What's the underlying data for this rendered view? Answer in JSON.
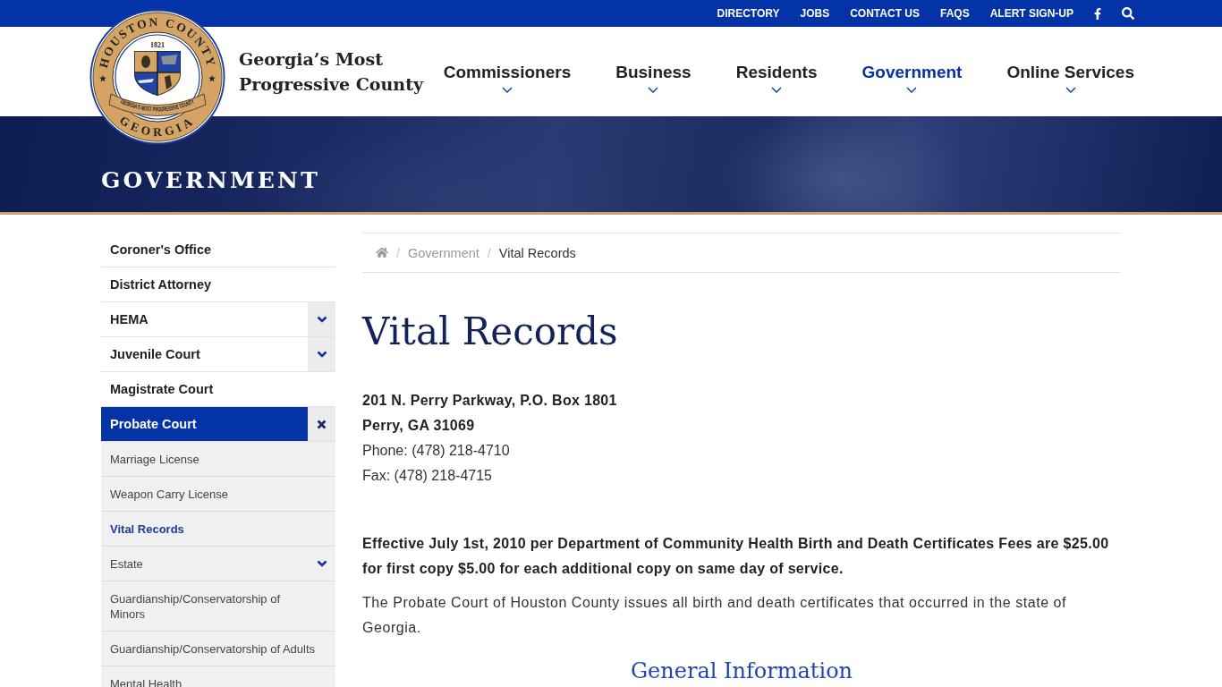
{
  "top_bar": {
    "links": [
      "DIRECTORY",
      "JOBS",
      "CONTACT US",
      "FAQS",
      "ALERT SIGN-UP"
    ]
  },
  "header": {
    "seal": {
      "top_text": "HOUSTON COUNTY",
      "year": "1821",
      "ribbon_text": "GEORGIA'S MOST PROGRESSIVE COUNTY",
      "bottom_text": "GEORGIA"
    },
    "tagline": "Georgia’s Most Progressive County"
  },
  "nav": [
    {
      "label": "Commissioners",
      "selected": false
    },
    {
      "label": "Business",
      "selected": false
    },
    {
      "label": "Residents",
      "selected": false
    },
    {
      "label": "Government",
      "selected": true
    },
    {
      "label": "Online Services",
      "selected": false
    }
  ],
  "hero": {
    "title": "GOVERNMENT"
  },
  "sidebar": {
    "items": [
      {
        "label": "Coroner's Office",
        "selected": false,
        "kind": "link"
      },
      {
        "label": "District Attorney",
        "selected": false,
        "kind": "link"
      },
      {
        "label": "HEMA",
        "selected": false,
        "kind": "group",
        "expanded": false
      },
      {
        "label": "Juvenile Court",
        "selected": false,
        "kind": "group",
        "expanded": false
      },
      {
        "label": "Magistrate Court",
        "selected": false,
        "kind": "link"
      },
      {
        "label": "Probate Court",
        "selected": true,
        "kind": "group",
        "expanded": true,
        "children": [
          {
            "label": "Marriage License",
            "selected": false,
            "kind": "link"
          },
          {
            "label": "Weapon Carry License",
            "selected": false,
            "kind": "link"
          },
          {
            "label": "Vital Records",
            "selected": true,
            "kind": "link"
          },
          {
            "label": "Estate",
            "selected": false,
            "kind": "group",
            "expanded": false
          },
          {
            "label": "Guardianship/Conservatorship of Minors",
            "selected": false,
            "kind": "link"
          },
          {
            "label": "Guardianship/Conservatorship of Adults",
            "selected": false,
            "kind": "link"
          },
          {
            "label": "Mental Health",
            "selected": false,
            "kind": "link"
          }
        ]
      }
    ]
  },
  "breadcrumb": {
    "items": [
      {
        "separator": "/",
        "label": "Government",
        "current": false
      },
      {
        "separator": "/",
        "label": "Vital Records",
        "current": true
      }
    ]
  },
  "content": {
    "title": "Vital Records",
    "address_lines": [
      {
        "text": "201 N. Perry Parkway, P.O. Box 1801",
        "bold": true
      },
      {
        "text": "Perry, GA 31069",
        "bold": true
      },
      {
        "text": "Phone: (478) 218-4710",
        "bold": false
      },
      {
        "text": "Fax: (478) 218-4715",
        "bold": false
      }
    ],
    "paragraphs": [
      {
        "text": "Effective July 1st, 2010 per Department of Community Health Birth and Death Certificates Fees are $25.00 for first copy $5.00 for each additional copy on same day of service.",
        "bold": true
      },
      {
        "text": "The Probate Court of Houston County issues all birth and death certificates that occurred in the state of Georgia.",
        "bold": false
      }
    ],
    "section_heading": "General Information"
  }
}
